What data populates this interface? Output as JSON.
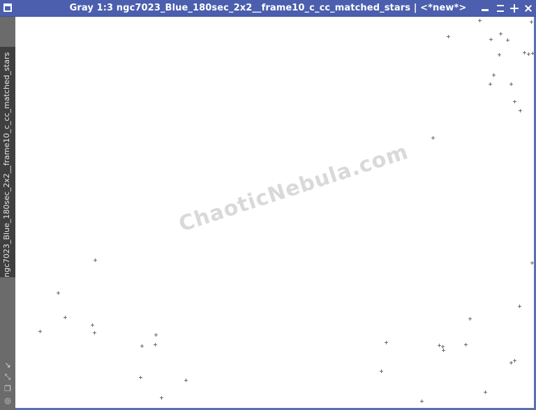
{
  "window": {
    "title": "Gray 1:3 ngc7023_Blue_180sec_2x2__frame10_c_cc_matched_stars | <*new*>",
    "vertical_tab_label": "ngc7023_Blue_180sec_2x2__frame10_c_cc_matched_stars",
    "controls": [
      "minimize-icon",
      "maximize-icon",
      "shade-icon",
      "close-icon"
    ]
  },
  "side_icons": [
    "resize-arrow-icon",
    "expand-icon",
    "copy-icon",
    "target-icon"
  ],
  "image": {
    "watermark": "ChaoticNebula.com",
    "colors": {
      "background": "#ffffff",
      "star_marker": "#6a6a6a",
      "titlebar": "#4b5fae"
    }
  }
}
